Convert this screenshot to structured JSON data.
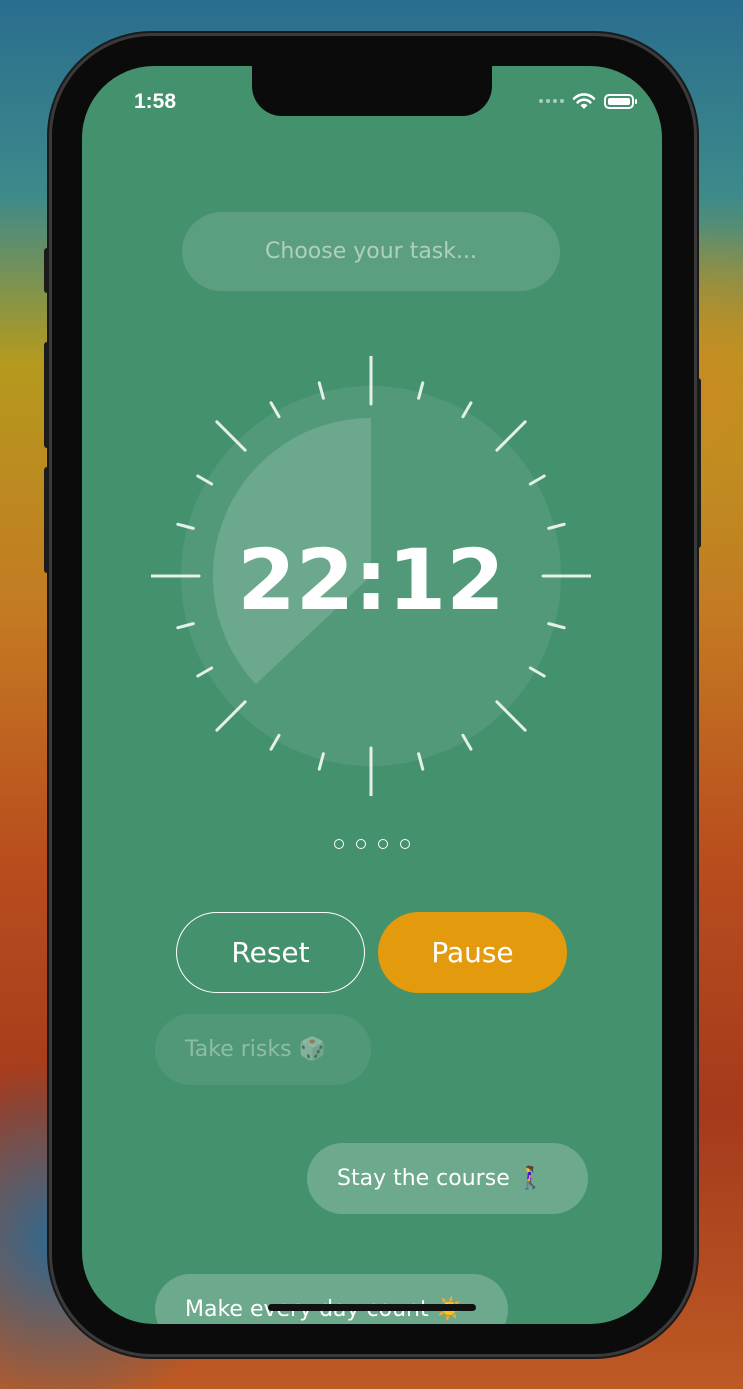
{
  "status_bar": {
    "time": "1:58"
  },
  "task": {
    "placeholder": "Choose your task..."
  },
  "timer": {
    "display": "22:12",
    "remaining_fraction": 0.37,
    "page_indicators": 4
  },
  "buttons": {
    "reset_label": "Reset",
    "pause_label": "Pause"
  },
  "quotes": [
    {
      "text": "Take risks 🎲"
    },
    {
      "text": "Stay the course 🚶‍♀️"
    },
    {
      "text": "Make every day count ☀️"
    }
  ],
  "colors": {
    "screen_background": "#44916e",
    "pause_button": "#e39a0d",
    "text": "#ffffff"
  },
  "icons": [
    "wifi-icon",
    "battery-icon",
    "cellular-signal-icon"
  ]
}
